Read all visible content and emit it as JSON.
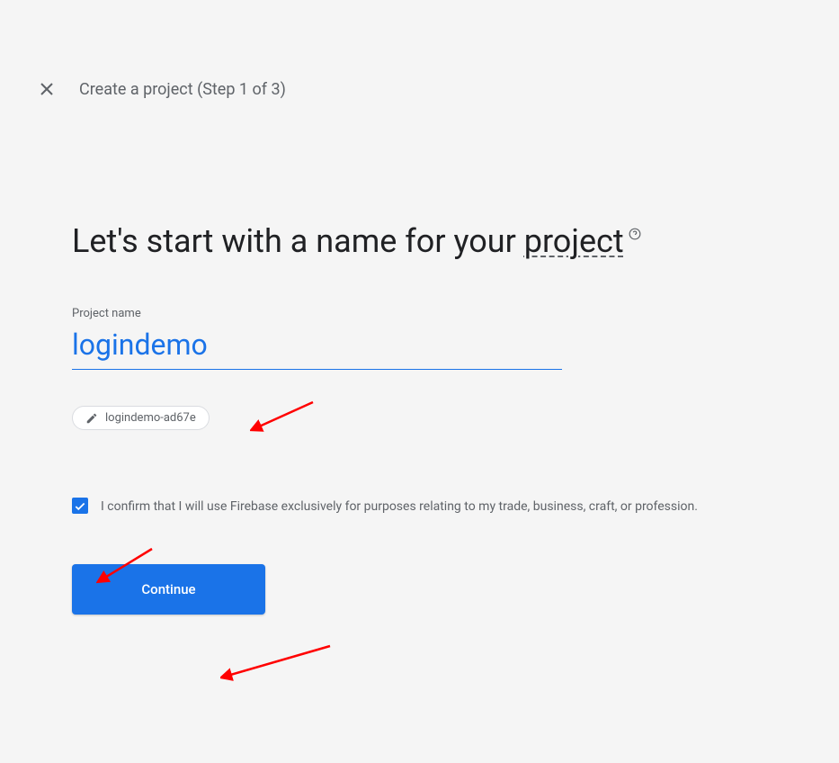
{
  "header": {
    "title": "Create a project (Step 1 of 3)"
  },
  "heading": {
    "prefix": "Let's start with a name for your ",
    "project_word": "project"
  },
  "form": {
    "project_name_label": "Project name",
    "project_name_value": "logindemo",
    "project_id": "logindemo-ad67e"
  },
  "confirmation": {
    "text": "I confirm that I will use Firebase exclusively for purposes relating to my trade, business, craft, or profession.",
    "checked": true
  },
  "actions": {
    "continue_label": "Continue"
  }
}
